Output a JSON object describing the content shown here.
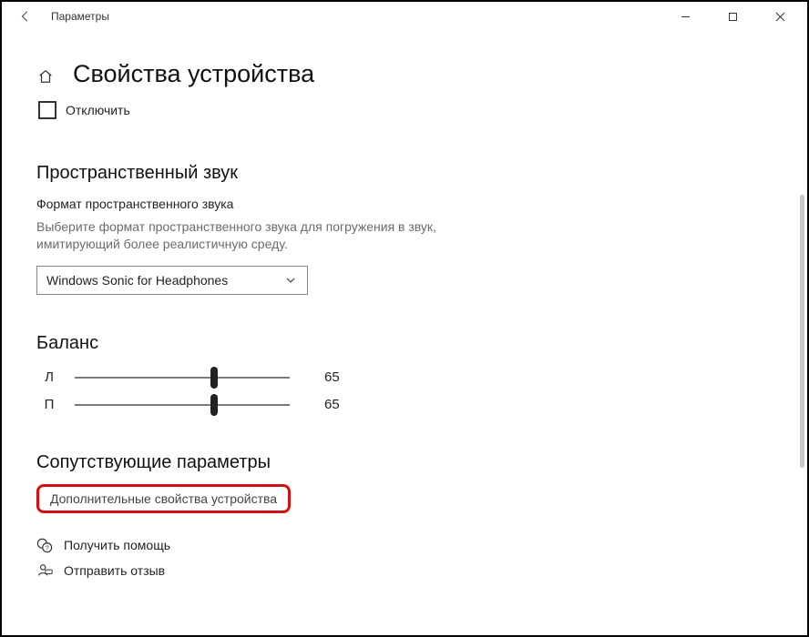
{
  "window": {
    "title": "Параметры"
  },
  "page": {
    "title": "Свойства устройства",
    "disable_label": "Отключить"
  },
  "spatial": {
    "heading": "Пространственный звук",
    "format_label": "Формат пространственного звука",
    "description": "Выберите формат пространственного звука для погружения в звук, имитирующий более реалистичную среду.",
    "selected": "Windows Sonic for Headphones"
  },
  "balance": {
    "heading": "Баланс",
    "left_label": "Л",
    "right_label": "П",
    "left_value": "65",
    "right_value": "65",
    "left_pct": 65,
    "right_pct": 65
  },
  "related": {
    "heading": "Сопутствующие параметры",
    "additional_props": "Дополнительные свойства устройства"
  },
  "footer": {
    "help": "Получить помощь",
    "feedback": "Отправить отзыв"
  }
}
